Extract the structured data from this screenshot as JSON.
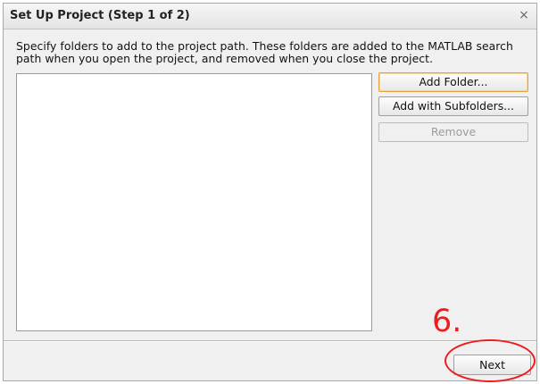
{
  "dialog": {
    "title": "Set Up Project (Step 1 of 2)",
    "close_glyph": "×",
    "instructions_line1": "Specify folders to add to the project path. These folders are added to the MATLAB search",
    "instructions_line2": "path when you open the project, and removed when you close the project.",
    "folder_list": [],
    "buttons": {
      "add_folder": "Add Folder...",
      "add_with_subfolders": "Add with Subfolders...",
      "remove": "Remove",
      "next": "Next"
    },
    "states": {
      "add_folder_focused": true,
      "remove_enabled": false
    }
  },
  "annotation": {
    "step_label": "6.",
    "color": "#ee1c1c",
    "highlights": "next-button"
  },
  "icons": {
    "close": "close-icon"
  }
}
